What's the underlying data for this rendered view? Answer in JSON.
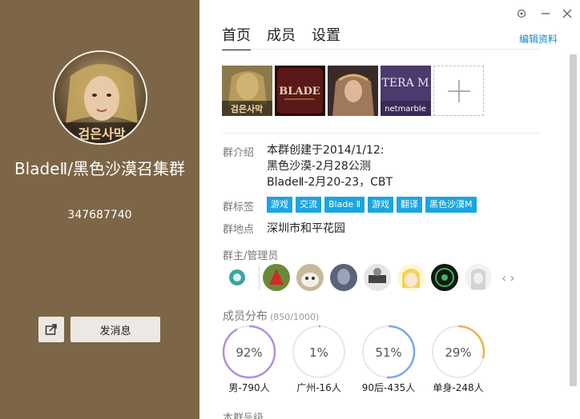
{
  "colors": {
    "left_bg": "#7c6647",
    "tag_bg": "#1ba5e0",
    "link": "#1a88c9",
    "gauge_purple": "#b08fe0",
    "gauge_blue": "#7aa8e8",
    "gauge_orange": "#f0b04a"
  },
  "window": {
    "controls": [
      "skin-icon",
      "minimize-icon",
      "close-icon"
    ]
  },
  "profile": {
    "name": "BladeⅡ/黑色沙漠召集群",
    "id": "347687740",
    "send_message_label": "发消息",
    "share_icon": "share-icon"
  },
  "tabs": [
    {
      "label": "首页",
      "active": true
    },
    {
      "label": "成员",
      "active": false
    },
    {
      "label": "设置",
      "active": false
    }
  ],
  "edit_label": "编辑资料",
  "games": [
    {
      "name": "검은사막",
      "color": "#8a7a4a"
    },
    {
      "name": "BLADE",
      "color": "#5a1818"
    },
    {
      "name": "",
      "color": "#6b4a4a"
    },
    {
      "name": "TERA M",
      "color": "#4a3a6e"
    }
  ],
  "games_brand": "netmarble",
  "info": {
    "intro_label": "群介绍",
    "intro_lines": [
      "本群创建于2014/1/12:",
      "黑色沙漠-2月28公测",
      "BladeⅡ-2月20-23，CBT"
    ],
    "tags_label": "群标签",
    "tags": [
      "游戏",
      "交流",
      "Blade Ⅱ",
      "游戏",
      "翻译",
      "黑色沙漠M"
    ],
    "place_label": "群地点",
    "place": "深圳市和平花园"
  },
  "admins": {
    "label": "群主/管理员",
    "avatars": [
      "avatar-1",
      "avatar-2",
      "avatar-3",
      "avatar-4",
      "avatar-5",
      "avatar-6",
      "avatar-7",
      "avatar-8"
    ]
  },
  "distribution": {
    "title": "成员分布",
    "count": "(850/1000)",
    "gauges": [
      {
        "percent_text": "92%",
        "value": 0.92,
        "label": "男-790人",
        "color": "#b08fe0"
      },
      {
        "percent_text": "1%",
        "value": 0.01,
        "label": "广州-16人",
        "color": "#7aa8e8"
      },
      {
        "percent_text": "51%",
        "value": 0.51,
        "label": "90后-435人",
        "color": "#7aa8e8"
      },
      {
        "percent_text": "29%",
        "value": 0.29,
        "label": "单身-248人",
        "color": "#f0b04a"
      }
    ]
  },
  "level_label": "本群등级"
}
